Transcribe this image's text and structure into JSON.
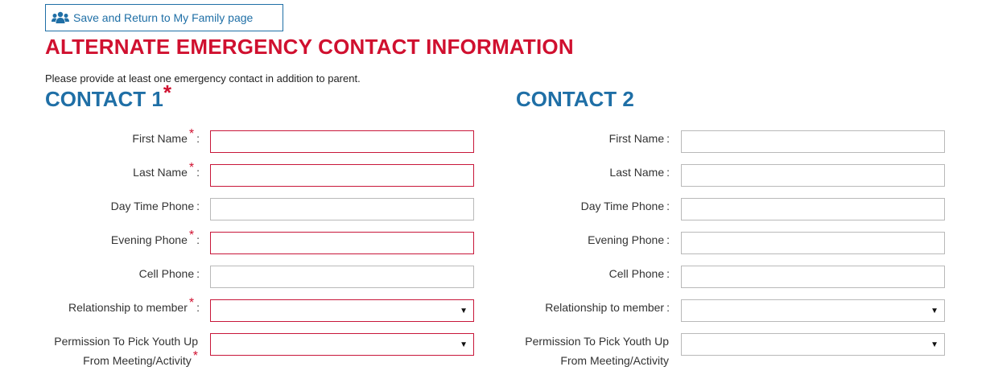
{
  "header": {
    "back_button_label": "Save and Return to My Family page",
    "title": "ALTERNATE EMERGENCY CONTACT INFORMATION",
    "intro": "Please provide at least one emergency contact in addition to parent."
  },
  "contact1": {
    "title": "CONTACT 1",
    "required_marker": "*",
    "labels": {
      "first_name": "First Name",
      "last_name": "Last Name",
      "day_phone": "Day Time Phone",
      "evening_phone": "Evening Phone",
      "cell_phone": "Cell Phone",
      "relationship": "Relationship to member",
      "permission_line1": "Permission To Pick Youth Up",
      "permission_line2": "From Meeting/Activity"
    },
    "values": {
      "first_name": "",
      "last_name": "",
      "day_phone": "",
      "evening_phone": "",
      "cell_phone": "",
      "relationship": "",
      "permission": ""
    }
  },
  "contact2": {
    "title": "CONTACT 2",
    "labels": {
      "first_name": "First Name",
      "last_name": "Last Name",
      "day_phone": "Day Time Phone",
      "evening_phone": "Evening Phone",
      "cell_phone": "Cell Phone",
      "relationship": "Relationship to member",
      "permission_line1": "Permission To Pick Youth Up",
      "permission_line2": "From Meeting/Activity"
    },
    "values": {
      "first_name": "",
      "last_name": "",
      "day_phone": "",
      "evening_phone": "",
      "cell_phone": "",
      "relationship": "",
      "permission": ""
    }
  },
  "common": {
    "colon": ":",
    "required_star": "*",
    "dropdown_caret": "▼"
  },
  "icons": {
    "back_button_icon": "users-icon"
  },
  "colors": {
    "title_red": "#d0102f",
    "heading_blue": "#1f6fa6",
    "required_border": "#c8173a"
  }
}
